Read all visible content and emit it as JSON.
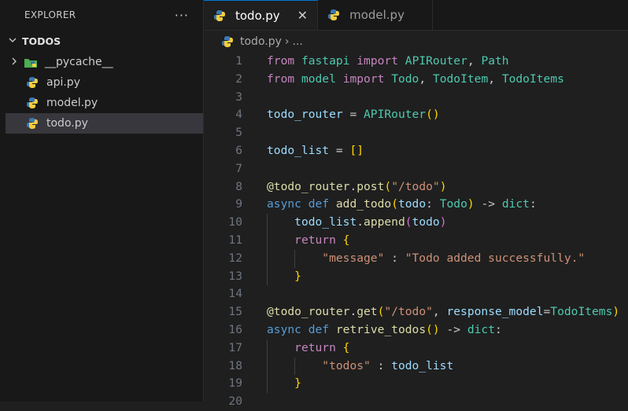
{
  "explorer": {
    "title": "EXPLORER",
    "more": "···",
    "section": "TODOS",
    "items": [
      {
        "label": "__pycache__",
        "type": "folder"
      },
      {
        "label": "api.py",
        "type": "file"
      },
      {
        "label": "model.py",
        "type": "file"
      },
      {
        "label": "todo.py",
        "type": "file",
        "selected": true
      }
    ]
  },
  "tabs": [
    {
      "label": "todo.py",
      "active": true,
      "close": "✕"
    },
    {
      "label": "model.py",
      "active": false
    }
  ],
  "breadcrumb": {
    "file": "todo.py",
    "sep": "›",
    "rest": "..."
  },
  "code": {
    "lines": [
      [
        [
          "imp",
          "from"
        ],
        [
          "",
          " "
        ],
        [
          "cls",
          "fastapi"
        ],
        [
          "",
          " "
        ],
        [
          "imp",
          "import"
        ],
        [
          "",
          " "
        ],
        [
          "cls",
          "APIRouter"
        ],
        [
          "",
          ", "
        ],
        [
          "cls",
          "Path"
        ]
      ],
      [
        [
          "imp",
          "from"
        ],
        [
          "",
          " "
        ],
        [
          "cls",
          "model"
        ],
        [
          "",
          " "
        ],
        [
          "imp",
          "import"
        ],
        [
          "",
          " "
        ],
        [
          "cls",
          "Todo"
        ],
        [
          "",
          ", "
        ],
        [
          "cls",
          "TodoItem"
        ],
        [
          "",
          ", "
        ],
        [
          "cls",
          "TodoItems"
        ]
      ],
      [],
      [
        [
          "var",
          "todo_router"
        ],
        [
          "",
          " = "
        ],
        [
          "cls",
          "APIRouter"
        ],
        [
          "br",
          "()"
        ]
      ],
      [],
      [
        [
          "var",
          "todo_list"
        ],
        [
          "",
          " = "
        ],
        [
          "br",
          "[]"
        ]
      ],
      [],
      [
        [
          "fn",
          "@todo_router"
        ],
        [
          "",
          "."
        ],
        [
          "fn",
          "post"
        ],
        [
          "br",
          "("
        ],
        [
          "str",
          "\"/todo\""
        ],
        [
          "br",
          ")"
        ]
      ],
      [
        [
          "kw",
          "async"
        ],
        [
          "",
          " "
        ],
        [
          "kw",
          "def"
        ],
        [
          "",
          " "
        ],
        [
          "fn",
          "add_todo"
        ],
        [
          "br",
          "("
        ],
        [
          "var",
          "todo"
        ],
        [
          "",
          ": "
        ],
        [
          "cls",
          "Todo"
        ],
        [
          "br",
          ")"
        ],
        [
          "",
          " -> "
        ],
        [
          "cls",
          "dict"
        ],
        [
          "",
          ":"
        ]
      ],
      [
        [
          "",
          "    "
        ],
        [
          "var",
          "todo_list"
        ],
        [
          "",
          "."
        ],
        [
          "fn",
          "append"
        ],
        [
          "br2",
          "("
        ],
        [
          "var",
          "todo"
        ],
        [
          "br2",
          ")"
        ]
      ],
      [
        [
          "",
          "    "
        ],
        [
          "imp",
          "return"
        ],
        [
          "",
          " "
        ],
        [
          "br",
          "{"
        ]
      ],
      [
        [
          "",
          "        "
        ],
        [
          "str",
          "\"message\""
        ],
        [
          "",
          " : "
        ],
        [
          "str",
          "\"Todo added successfully.\""
        ]
      ],
      [
        [
          "",
          "    "
        ],
        [
          "br",
          "}"
        ]
      ],
      [],
      [
        [
          "fn",
          "@todo_router"
        ],
        [
          "",
          "."
        ],
        [
          "fn",
          "get"
        ],
        [
          "br",
          "("
        ],
        [
          "str",
          "\"/todo\""
        ],
        [
          "",
          ", "
        ],
        [
          "var",
          "response_model"
        ],
        [
          "",
          "="
        ],
        [
          "cls",
          "TodoItems"
        ],
        [
          "br",
          ")"
        ]
      ],
      [
        [
          "kw",
          "async"
        ],
        [
          "",
          " "
        ],
        [
          "kw",
          "def"
        ],
        [
          "",
          " "
        ],
        [
          "fn",
          "retrive_todos"
        ],
        [
          "br",
          "()"
        ],
        [
          "",
          " -> "
        ],
        [
          "cls",
          "dict"
        ],
        [
          "",
          ":"
        ]
      ],
      [
        [
          "",
          "    "
        ],
        [
          "imp",
          "return"
        ],
        [
          "",
          " "
        ],
        [
          "br",
          "{"
        ]
      ],
      [
        [
          "",
          "        "
        ],
        [
          "str",
          "\"todos\""
        ],
        [
          "",
          " : "
        ],
        [
          "var",
          "todo_list"
        ]
      ],
      [
        [
          "",
          "    "
        ],
        [
          "br",
          "}"
        ]
      ],
      []
    ]
  },
  "colors": {
    "accent": "#0078d4",
    "selected": "#37373d"
  }
}
